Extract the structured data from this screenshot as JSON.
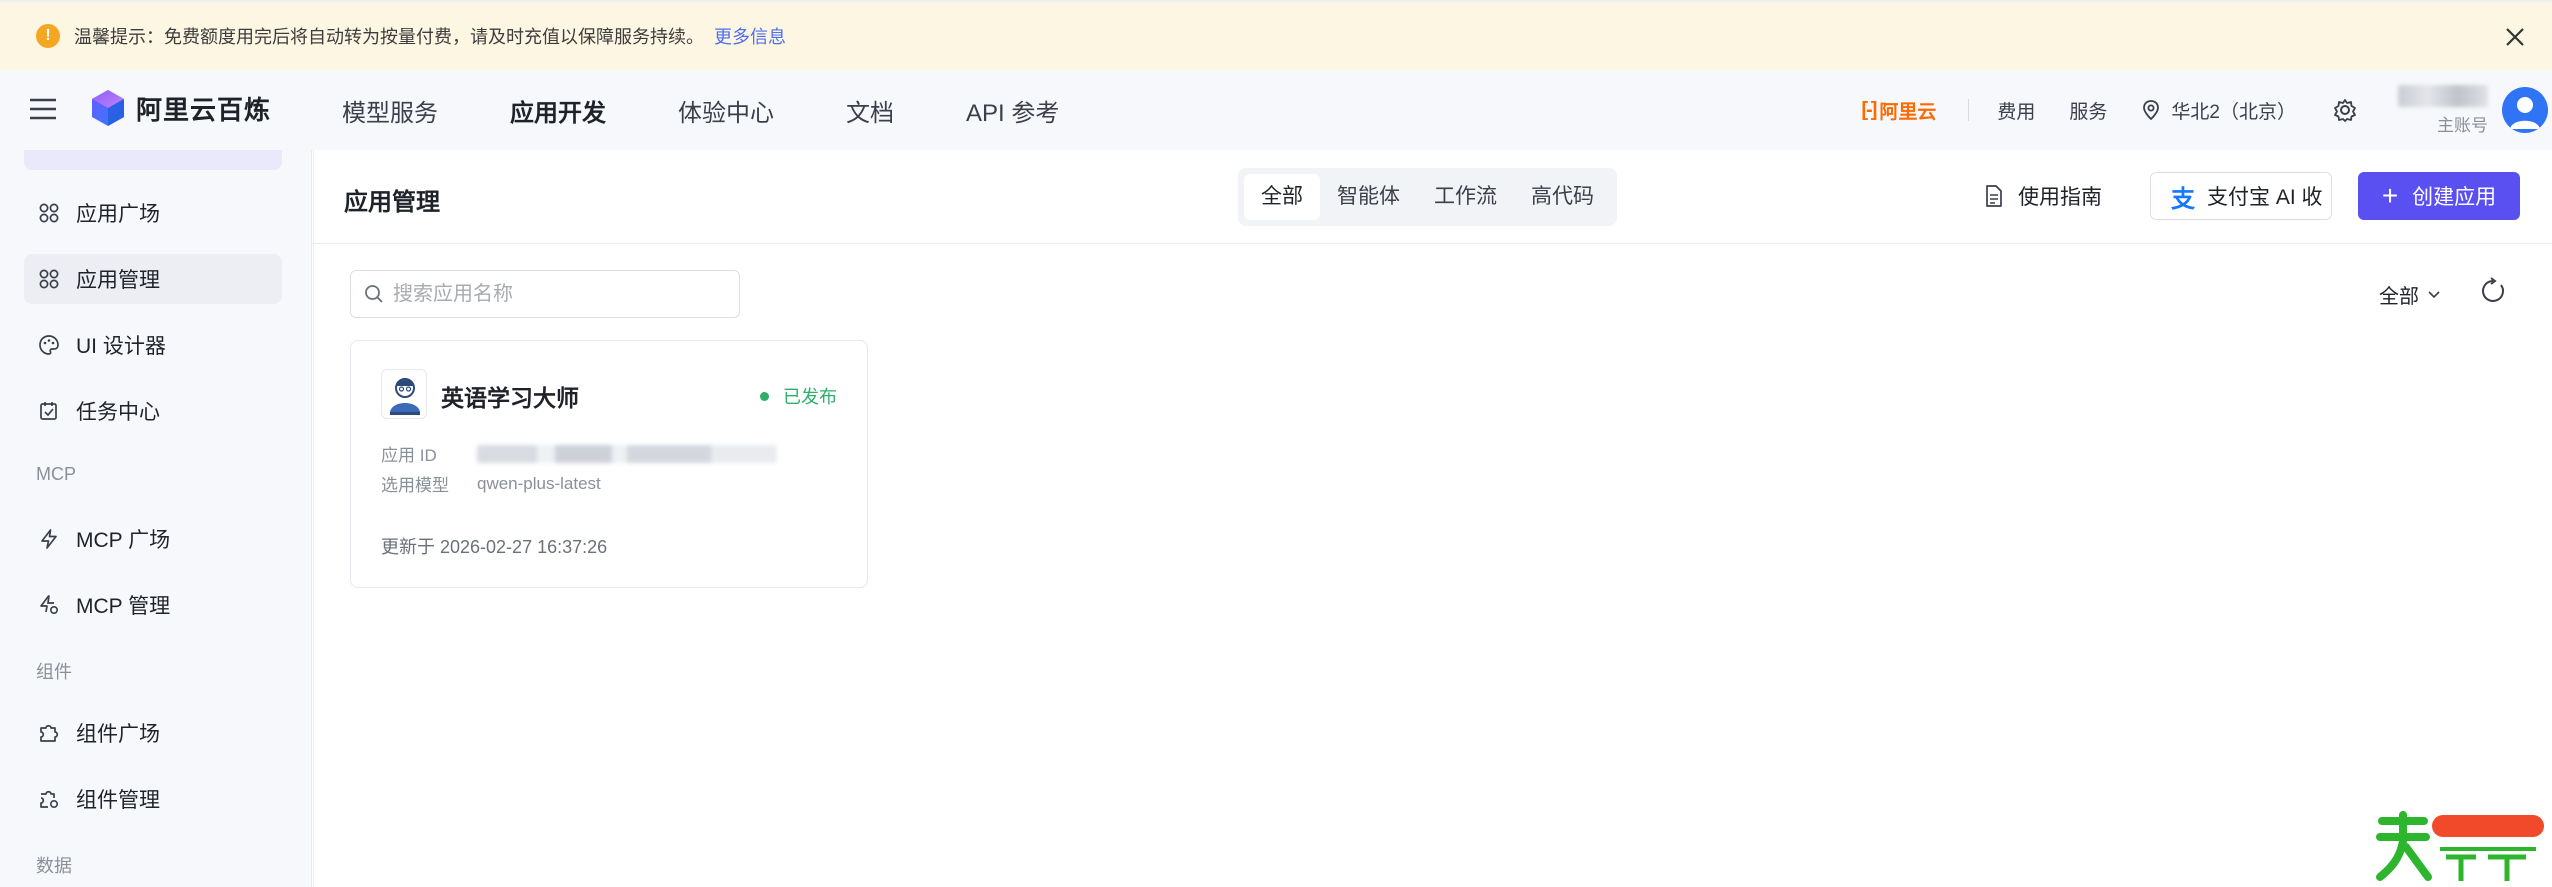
{
  "notice": {
    "text": "温馨提示：免费额度用完后将自动转为按量付费，请及时充值以保障服务持续。",
    "more_link": "更多信息"
  },
  "topnav": {
    "brand": "阿里云百炼",
    "links": [
      {
        "label": "模型服务",
        "active": false
      },
      {
        "label": "应用开发",
        "active": true
      },
      {
        "label": "体验中心",
        "active": false
      },
      {
        "label": "文档",
        "active": false
      },
      {
        "label": "API 参考",
        "active": false
      }
    ],
    "aliyun": "阿里云",
    "fees": "费用",
    "service": "服务",
    "region": "华北2（北京）",
    "account_label": "主账号"
  },
  "sidebar": {
    "items": [
      {
        "label": "应用广场",
        "icon": "apps-grid-icon",
        "active": false
      },
      {
        "label": "应用管理",
        "icon": "apps-grid-icon",
        "active": true
      },
      {
        "label": "UI 设计器",
        "icon": "palette-icon",
        "active": false
      },
      {
        "label": "任务中心",
        "icon": "task-check-icon",
        "active": false
      }
    ],
    "group_mcp": "MCP",
    "mcp_items": [
      {
        "label": "MCP 广场",
        "icon": "bolt-icon"
      },
      {
        "label": "MCP 管理",
        "icon": "bolt-gear-icon"
      }
    ],
    "group_components": "组件",
    "component_items": [
      {
        "label": "组件广场",
        "icon": "puzzle-icon"
      },
      {
        "label": "组件管理",
        "icon": "puzzle-gear-icon"
      }
    ],
    "group_data": "数据"
  },
  "main": {
    "title": "应用管理",
    "segments": [
      {
        "label": "全部",
        "active": true
      },
      {
        "label": "智能体",
        "active": false
      },
      {
        "label": "工作流",
        "active": false
      },
      {
        "label": "高代码",
        "active": false
      }
    ],
    "guide_label": "使用指南",
    "alipay_label": "支付宝 AI 收",
    "create_label": "创建应用",
    "search_placeholder": "搜索应用名称",
    "filter_label": "全部"
  },
  "app_card": {
    "name": "英语学习大师",
    "status": "已发布",
    "id_label": "应用 ID",
    "model_label": "选用模型",
    "model_value": "qwen-plus-latest",
    "updated": "更新于 2026-02-27 16:37:26"
  },
  "colors": {
    "accent": "#5a4ff0",
    "published": "#2fae6a",
    "warning": "#f5a623",
    "aliyun_orange": "#ff6a00"
  }
}
